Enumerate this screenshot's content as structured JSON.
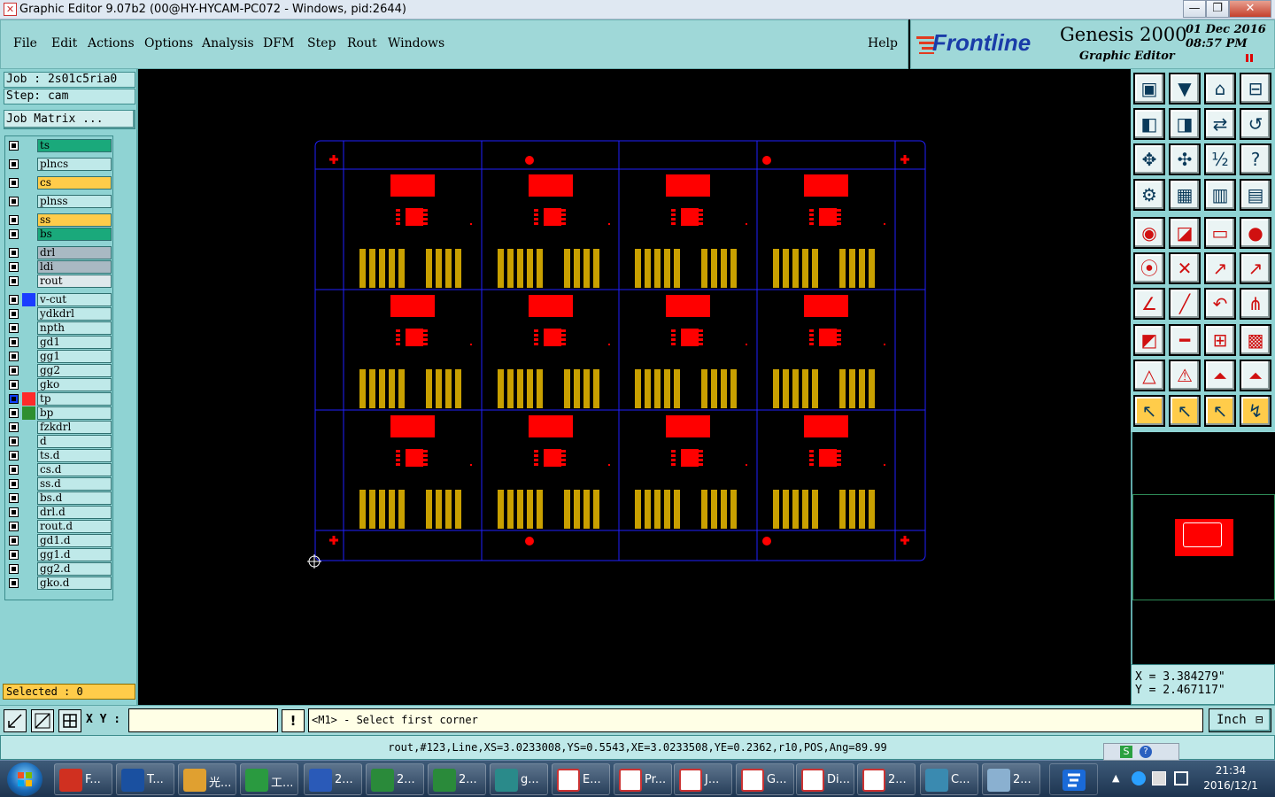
{
  "window": {
    "title": "Graphic Editor 9.07b2 (00@HY-HYCAM-PC072 - Windows, pid:2644)",
    "controls": [
      "—",
      "❐",
      "✕"
    ]
  },
  "menu": {
    "items": [
      "File",
      "Edit",
      "Actions",
      "Options",
      "Analysis",
      "DFM",
      "Step",
      "Rout",
      "Windows"
    ],
    "help": "Help"
  },
  "brand": {
    "logo": "Frontline",
    "product": "Genesis 2000",
    "subtitle": "Graphic Editor",
    "date": "01  Dec  2016",
    "time": "08:57  PM"
  },
  "job": {
    "job_label": "Job : 2s01c5ria0",
    "step_label": "Step: cam",
    "matrix_button": "Job Matrix ..."
  },
  "layers": [
    {
      "name": "ts",
      "color": "#1aa97b",
      "swatch": ""
    },
    {
      "name": "plncs",
      "color": "#bfe9e9",
      "swatch": ""
    },
    {
      "name": "cs",
      "color": "#ffcc4a",
      "swatch": ""
    },
    {
      "name": "plnss",
      "color": "#bfe9e9",
      "swatch": ""
    },
    {
      "name": "ss",
      "color": "#ffcc4a",
      "swatch": ""
    },
    {
      "name": "bs",
      "color": "#1aa97b",
      "swatch": ""
    },
    {
      "name": "drl",
      "color": "#a9b9c3",
      "swatch": ""
    },
    {
      "name": "ldi",
      "color": "#a9b9c3",
      "swatch": ""
    },
    {
      "name": "rout",
      "color": "#dfe9ec",
      "swatch": ""
    },
    {
      "name": "v-cut",
      "color": "#bfe9e9",
      "swatch": "#1a3cff"
    },
    {
      "name": "ydkdrl",
      "color": "#bfe9e9",
      "swatch": ""
    },
    {
      "name": "npth",
      "color": "#bfe9e9",
      "swatch": ""
    },
    {
      "name": "gd1",
      "color": "#bfe9e9",
      "swatch": ""
    },
    {
      "name": "gg1",
      "color": "#bfe9e9",
      "swatch": "",
      "mark": "✎"
    },
    {
      "name": "gg2",
      "color": "#bfe9e9",
      "swatch": ""
    },
    {
      "name": "gko",
      "color": "#bfe9e9",
      "swatch": ""
    },
    {
      "name": "tp",
      "color": "#bfe9e9",
      "swatch": "#ff2a2a",
      "mark": "▦"
    },
    {
      "name": "bp",
      "color": "#bfe9e9",
      "swatch": "#2f8f2f"
    },
    {
      "name": "fzkdrl",
      "color": "#bfe9e9",
      "swatch": ""
    },
    {
      "name": "d",
      "color": "#bfe9e9",
      "swatch": ""
    },
    {
      "name": "ts.d",
      "color": "#bfe9e9",
      "swatch": ""
    },
    {
      "name": "cs.d",
      "color": "#bfe9e9",
      "swatch": ""
    },
    {
      "name": "ss.d",
      "color": "#bfe9e9",
      "swatch": ""
    },
    {
      "name": "bs.d",
      "color": "#bfe9e9",
      "swatch": ""
    },
    {
      "name": "drl.d",
      "color": "#bfe9e9",
      "swatch": ""
    },
    {
      "name": "rout.d",
      "color": "#bfe9e9",
      "swatch": ""
    },
    {
      "name": "gd1.d",
      "color": "#bfe9e9",
      "swatch": ""
    },
    {
      "name": "gg1.d",
      "color": "#bfe9e9",
      "swatch": "",
      "mark": "✎"
    },
    {
      "name": "gg2.d",
      "color": "#bfe9e9",
      "swatch": ""
    },
    {
      "name": "gko.d",
      "color": "#bfe9e9",
      "swatch": ""
    }
  ],
  "selected_label": "Selected : 0",
  "coords": {
    "x": "X = 3.384279\"",
    "y": "Y = 2.467117\""
  },
  "command": {
    "xy_label": "X Y :",
    "xy_value": "",
    "prompt": "<M1> - Select first corner",
    "units": "Inch"
  },
  "status": "rout,#123,Line,XS=3.0233008,YS=0.5543,XE=3.0233508,YE=0.2362,r10,POS,Ang=89.99",
  "colors": {
    "panel": "#8fd3d3",
    "pad": "#ff0000",
    "finger": "#c9a000",
    "outline": "#2020ff"
  },
  "taskbar": {
    "tasks": [
      "F...",
      "T...",
      "光...",
      "工...",
      "2...",
      "2...",
      "2...",
      "g...",
      "E...",
      "Pr...",
      "J...",
      "G...",
      "Di...",
      "2...",
      "C...",
      "2..."
    ],
    "clock_time": "21:34",
    "clock_date": "2016/12/1"
  }
}
